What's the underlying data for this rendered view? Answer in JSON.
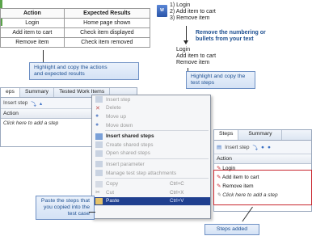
{
  "excel": {
    "headers": [
      "Action",
      "Expected Results"
    ],
    "rows": [
      [
        "Login",
        "Home page shown"
      ],
      [
        "Add item to cart",
        "Check item displayed"
      ],
      [
        "Remove item",
        "Check item removed"
      ]
    ]
  },
  "callouts": {
    "highlight_excel": "Highlight and copy the actions\nand expected results",
    "remove_numbering": "Remove the numbering or\nbullets from your text",
    "highlight_steps": "Highlight and copy the\ntest steps",
    "paste_steps": "Paste the steps that\nyou copied into the\ntest case",
    "steps_added": "Steps added"
  },
  "word_doc": {
    "numbered": [
      "1) Login",
      "2) Add item to cart",
      "3) Remove item"
    ],
    "plain": [
      "Login",
      "Add item to cart",
      "Remove item"
    ]
  },
  "left_panel": {
    "tabs": [
      "eps",
      "Summary",
      "Tested Work Items"
    ],
    "insert_step": "Insert step",
    "column": "Action",
    "placeholder": "Click here to add a step"
  },
  "context_menu": {
    "items": [
      {
        "label": "Insert step",
        "shortcut": "",
        "state": "disabled",
        "icon": "insert-step-icon"
      },
      {
        "label": "Delete",
        "shortcut": "",
        "state": "disabled",
        "icon": "delete-icon"
      },
      {
        "label": "Move up",
        "shortcut": "",
        "state": "disabled",
        "icon": "move-up-icon"
      },
      {
        "label": "Move down",
        "shortcut": "",
        "state": "disabled",
        "icon": "move-down-icon"
      },
      {
        "label": "Insert shared steps",
        "shortcut": "",
        "state": "enabled",
        "icon": "insert-shared-steps-icon"
      },
      {
        "label": "Create shared steps",
        "shortcut": "",
        "state": "disabled",
        "icon": "create-shared-steps-icon"
      },
      {
        "label": "Open shared steps",
        "shortcut": "",
        "state": "disabled",
        "icon": "open-shared-steps-icon"
      },
      {
        "label": "Insert parameter",
        "shortcut": "",
        "state": "disabled",
        "icon": "insert-parameter-icon"
      },
      {
        "label": "Manage test step attachments",
        "shortcut": "",
        "state": "disabled",
        "icon": "attachments-icon"
      },
      {
        "label": "Copy",
        "shortcut": "Ctrl+C",
        "state": "disabled",
        "icon": "copy-icon"
      },
      {
        "label": "Cut",
        "shortcut": "Ctrl+X",
        "state": "disabled",
        "icon": "cut-icon"
      },
      {
        "label": "Paste",
        "shortcut": "Ctrl+V",
        "state": "selected",
        "icon": "paste-icon"
      }
    ]
  },
  "right_panel": {
    "tabs": [
      "Steps",
      "Summary"
    ],
    "insert_step": "Insert step",
    "column": "Action",
    "steps": [
      "Login",
      "Add item to cart",
      "Remove item"
    ],
    "placeholder": "Click here to add a step"
  },
  "colors": {
    "callout_text": "#1d4f91",
    "selected": "#1f3f8f",
    "highlight_box": "#c8262e"
  }
}
